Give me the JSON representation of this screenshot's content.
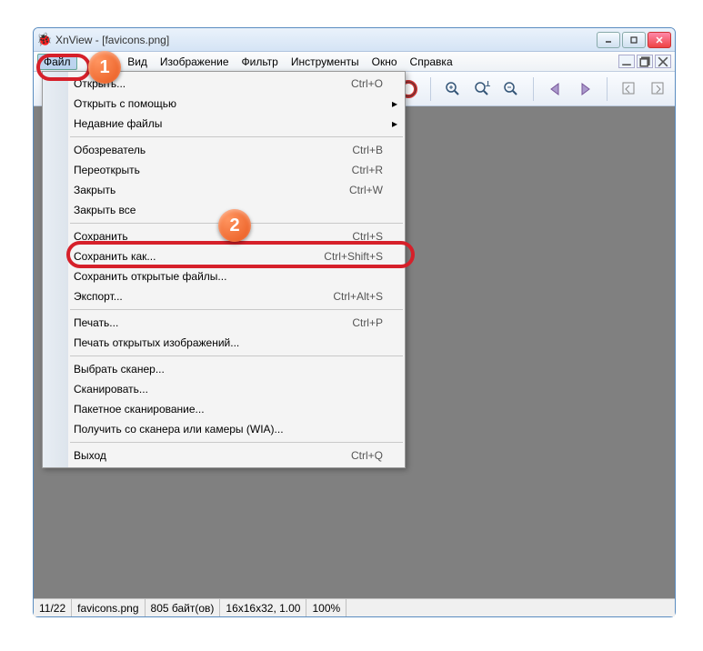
{
  "title": "XnView - [favicons.png]",
  "menubar": [
    "Файл",
    "Правка",
    "Вид",
    "Изображение",
    "Фильтр",
    "Инструменты",
    "Окно",
    "Справка"
  ],
  "menu_visible_cut": "а",
  "dropdown": {
    "groups": [
      [
        {
          "label": "Открыть...",
          "shortcut": "Ctrl+O"
        },
        {
          "label": "Открыть с помощью",
          "submenu": true
        },
        {
          "label": "Недавние файлы",
          "submenu": true
        }
      ],
      [
        {
          "label": "Обозреватель",
          "shortcut": "Ctrl+B"
        },
        {
          "label": "Переоткрыть",
          "shortcut": "Ctrl+R"
        },
        {
          "label": "Закрыть",
          "shortcut": "Ctrl+W"
        },
        {
          "label": "Закрыть все"
        }
      ],
      [
        {
          "label": "Сохранить",
          "shortcut": "Ctrl+S"
        },
        {
          "label": "Сохранить как...",
          "shortcut": "Ctrl+Shift+S",
          "highlight": true
        },
        {
          "label": "Сохранить открытые файлы..."
        },
        {
          "label": "Экспорт...",
          "shortcut": "Ctrl+Alt+S"
        }
      ],
      [
        {
          "label": "Печать...",
          "shortcut": "Ctrl+P"
        },
        {
          "label": "Печать открытых изображений..."
        }
      ],
      [
        {
          "label": "Выбрать сканер..."
        },
        {
          "label": "Сканировать..."
        },
        {
          "label": "Пакетное сканирование..."
        },
        {
          "label": "Получить со сканера или камеры (WIA)..."
        }
      ],
      [
        {
          "label": "Выход",
          "shortcut": "Ctrl+Q"
        }
      ]
    ]
  },
  "status": {
    "pos": "11/22",
    "file": "favicons.png",
    "size": "805 байт(ов)",
    "dims": "16x16x32, 1.00",
    "zoom": "100%"
  }
}
